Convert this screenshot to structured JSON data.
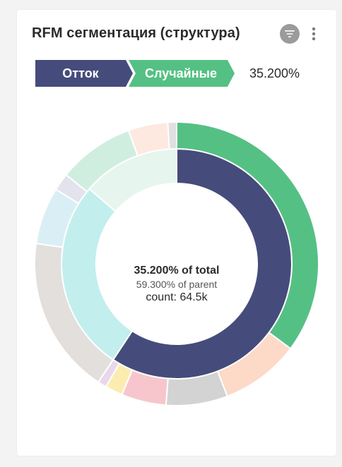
{
  "widget": {
    "title": "RFM сегментация (структура)"
  },
  "breadcrumb": {
    "items": [
      {
        "label": "Отток",
        "color": "#454c7b"
      },
      {
        "label": "Случайные",
        "color": "#55c084"
      }
    ],
    "value": "35.200%"
  },
  "center": {
    "line1": "35.200% of total",
    "line2": "59.300% of parent",
    "line3": "count: 64.5k"
  },
  "chart_data": {
    "type": "sunburst",
    "inner_ring": [
      {
        "name": "Отток",
        "value": 59.3,
        "color": "#454c7b"
      },
      {
        "value": 27.0,
        "color": "#c2eeee"
      },
      {
        "value": 13.7,
        "color": "#e6f6ee"
      }
    ],
    "outer_ring": [
      {
        "name": "Случайные",
        "value": 35.2,
        "color": "#55c084"
      },
      {
        "value": 9.0,
        "color": "#fdd9c7"
      },
      {
        "value": 7.0,
        "color": "#d3d3d3"
      },
      {
        "value": 5.1,
        "color": "#f7c6cc"
      },
      {
        "value": 2.0,
        "color": "#fdecb0"
      },
      {
        "value": 1.0,
        "color": "#e9d8ec"
      },
      {
        "value": 18.0,
        "color": "#e2dfdc"
      },
      {
        "value": 6.5,
        "color": "#daeff5"
      },
      {
        "value": 2.0,
        "color": "#e3e3ee"
      },
      {
        "value": 8.7,
        "color": "#d0eedf"
      },
      {
        "value": 4.5,
        "color": "#fde9e0"
      },
      {
        "value": 1.0,
        "color": "#e0e0e0"
      }
    ]
  },
  "icons": {
    "filter": "filter-icon",
    "menu": "more-vertical-icon"
  }
}
